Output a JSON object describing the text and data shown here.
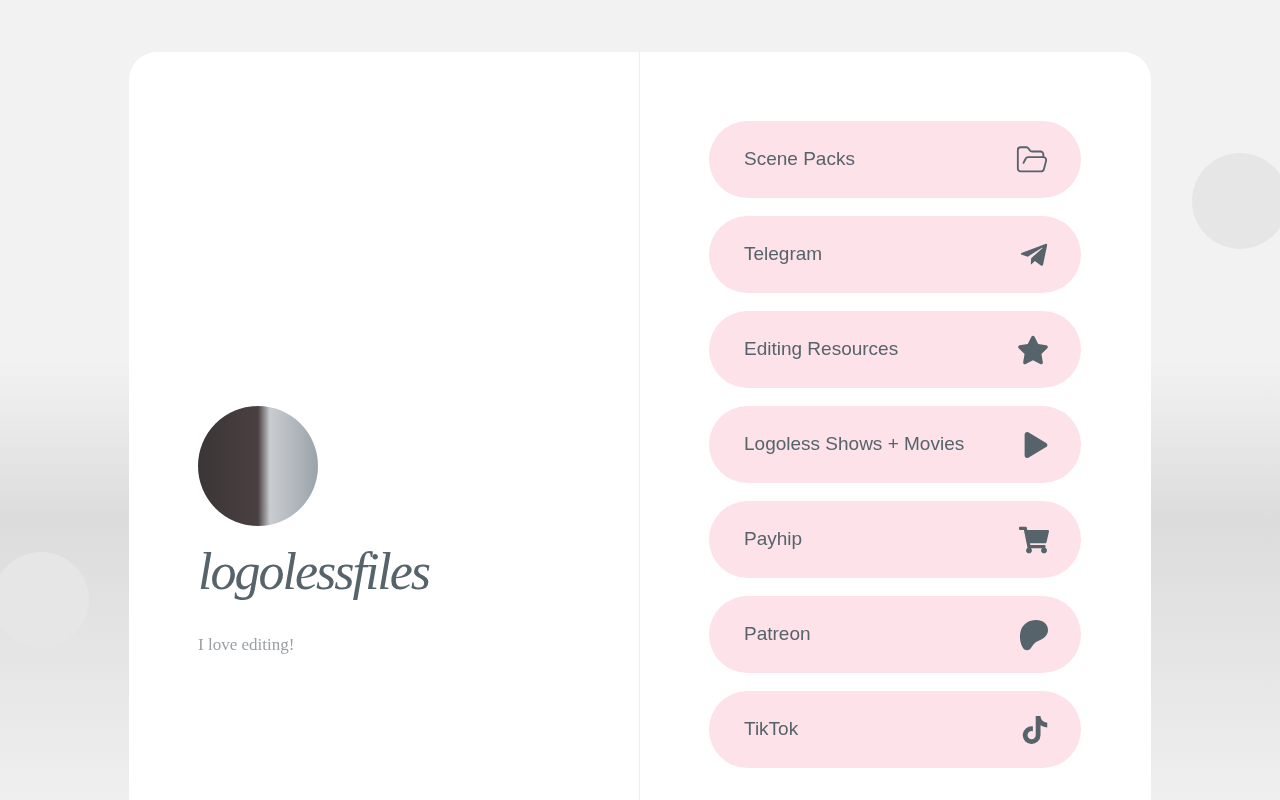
{
  "profile": {
    "name": "logolessfiles",
    "bio": "I love editing!"
  },
  "links": [
    {
      "label": "Scene Packs",
      "kind": "folder"
    },
    {
      "label": "Telegram",
      "kind": "telegram"
    },
    {
      "label": "Editing Resources",
      "kind": "star"
    },
    {
      "label": "Logoless Shows + Movies",
      "kind": "play"
    },
    {
      "label": "Payhip",
      "kind": "cart"
    },
    {
      "label": "Patreon",
      "kind": "patreon"
    },
    {
      "label": "TikTok",
      "kind": "tiktok"
    }
  ]
}
